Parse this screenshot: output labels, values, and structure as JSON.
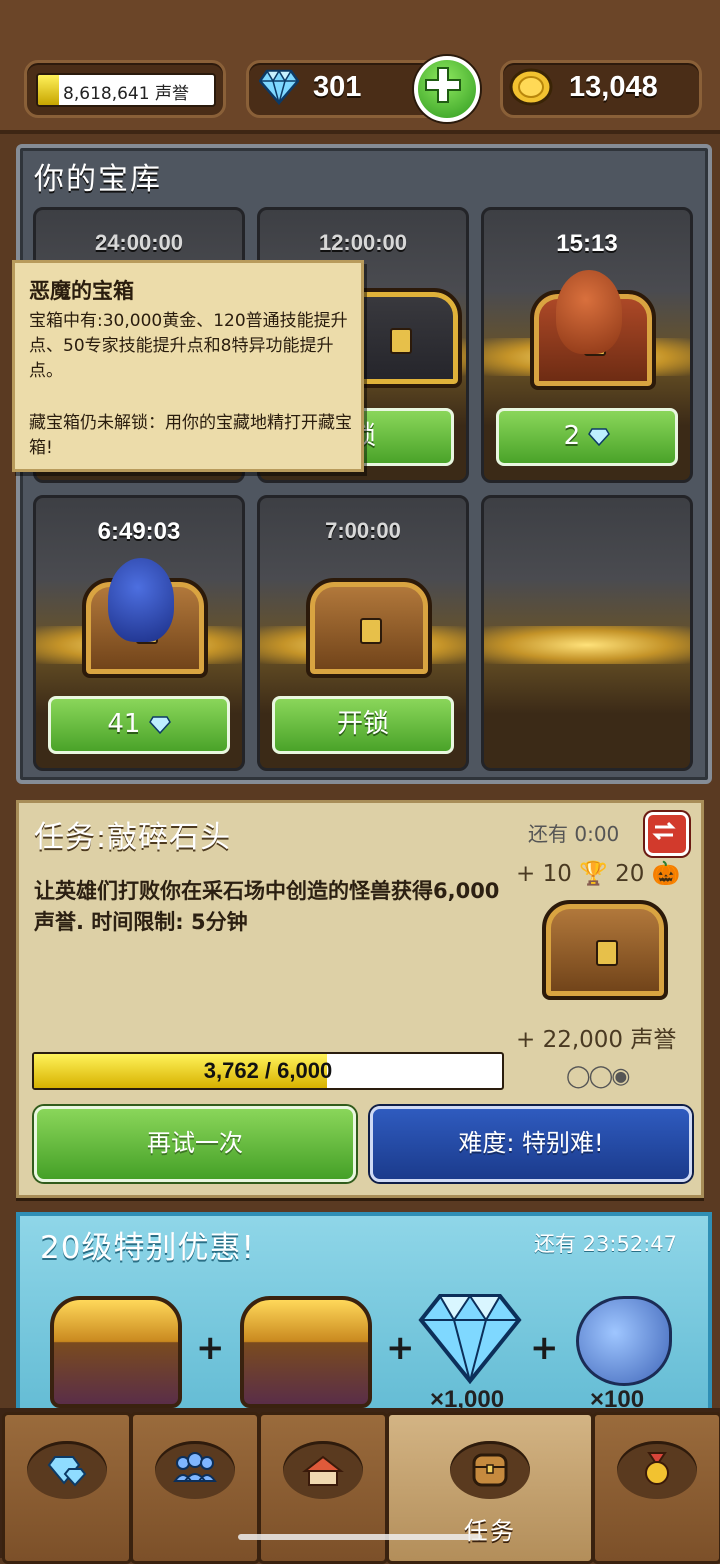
{
  "header": {
    "reputation_text": "8,618,641 声誉",
    "reputation_fill_fraction": 0.12,
    "gems": "301",
    "gold": "13,048",
    "icons": {
      "gem": "diamond-icon",
      "add": "plus-icon",
      "gold": "gold-coin-icon"
    }
  },
  "vault": {
    "title": "你的宝库",
    "slots": [
      {
        "timer": "24:00:00",
        "button": ""
      },
      {
        "timer": "12:00:00",
        "button": "锁"
      },
      {
        "timer": "15:13",
        "button": "2"
      },
      {
        "timer": "6:49:03",
        "button": "41"
      },
      {
        "timer": "7:00:00",
        "button": "开锁"
      },
      {
        "timer": "",
        "button": ""
      }
    ]
  },
  "tooltip": {
    "title": "恶魔的宝箱",
    "body": "宝箱中有:30,000黄金、120普通技能提升点、50专家技能提升点和8特异功能提升点。",
    "body2": "藏宝箱仍未解锁：用你的宝藏地精打开藏宝箱!"
  },
  "quest": {
    "title": "任务:敲碎石头",
    "remaining": "还有 0:00",
    "description": "让英雄们打败你在采石场中创造的怪兽获得6,000声誉. 时间限制: 5分钟",
    "reward_top": "+ 10 🏆 20 🎃",
    "reward_rep": "+ 22,000 声誉",
    "difficulty_dots": "◯◯◉",
    "progress_text": "3,762 / 6,000",
    "progress_fraction": 0.627,
    "retry_label": "再试一次",
    "difficulty_label": "难度: 特别难!"
  },
  "offer": {
    "title": "20级特别优惠!",
    "time": "还有 23:52:47",
    "plus": "+",
    "gem_mult": "×1,000",
    "unicorn_mult": "×100"
  },
  "nav": {
    "tabs": [
      {
        "icon": "gem-shop-icon",
        "label": ""
      },
      {
        "icon": "heroes-icon",
        "label": ""
      },
      {
        "icon": "village-icon",
        "label": ""
      },
      {
        "icon": "quest-chest-icon",
        "label": "任务"
      },
      {
        "icon": "achievement-medal-icon",
        "label": ""
      }
    ]
  }
}
